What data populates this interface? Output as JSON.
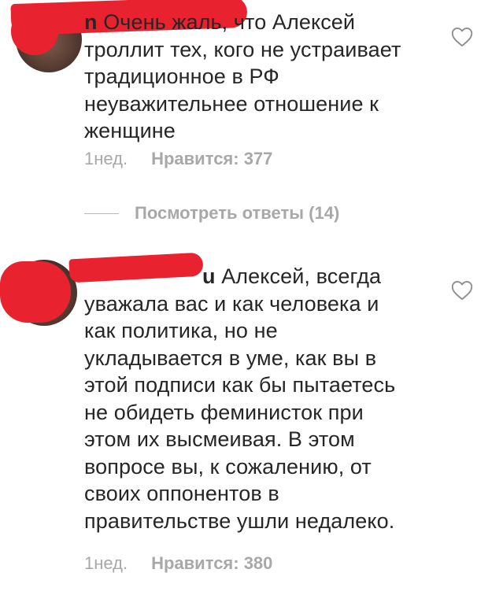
{
  "comments": [
    {
      "username_visible": "n",
      "text": "Очень жаль, что Алексей троллит тех, кого не устраивает традиционное в РФ неуважительнее отношение к женщине",
      "time": "1нед.",
      "likes": "Нравится: 377",
      "like_icon": "heart-outline-icon"
    },
    {
      "username_visible": "u",
      "text": "Алексей, всегда уважала вас и как человека и как политика, но не укладывается в уме, как вы в этой подписи как бы пытаетесь не обидеть феминисток при этом их высмеивая. В этом вопросе вы, к сожалению, от своих оппонентов в правительстве ушли недалеко.",
      "time": "1нед.",
      "likes": "Нравится: 380",
      "like_icon": "heart-outline-icon"
    }
  ],
  "replies": {
    "label": "Посмотреть ответы (14)"
  },
  "colors": {
    "text": "#262626",
    "secondary": "#a8a8a8",
    "redaction": "#e8232f"
  }
}
